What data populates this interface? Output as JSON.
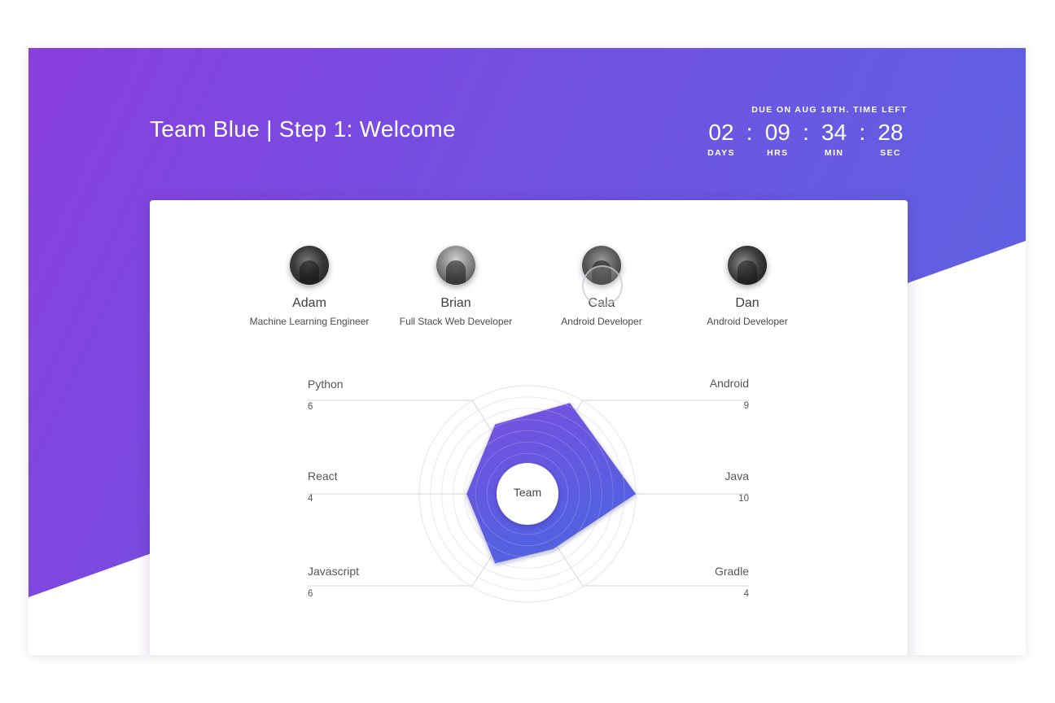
{
  "header": {
    "title": "Team Blue | Step 1: Welcome"
  },
  "countdown": {
    "caption": "DUE ON AUG 18TH. TIME LEFT",
    "days": "02",
    "hours": "09",
    "minutes": "34",
    "seconds": "28",
    "separator": ":",
    "days_label": "DAYS",
    "hours_label": "HRS",
    "minutes_label": "MIN",
    "seconds_label": "SEC"
  },
  "members": [
    {
      "name": "Adam",
      "role": "Machine Learning Engineer"
    },
    {
      "name": "Brian",
      "role": "Full Stack Web Developer"
    },
    {
      "name": "Cala",
      "role": "Android Developer"
    },
    {
      "name": "Dan",
      "role": "Android Developer"
    }
  ],
  "chart_data": {
    "type": "radar",
    "center_label": "Team",
    "axes": [
      "Python",
      "Android",
      "Java",
      "Gradle",
      "Javascript",
      "React"
    ],
    "values": [
      6,
      9,
      10,
      4,
      6,
      4
    ],
    "max": 10,
    "fill_color_top": "#7a4fe0",
    "fill_color_bottom": "#4f63e0"
  },
  "skills": {
    "python": {
      "name": "Python",
      "value": "6"
    },
    "react": {
      "name": "React",
      "value": "4"
    },
    "javascript": {
      "name": "Javascript",
      "value": "6"
    },
    "android": {
      "name": "Android",
      "value": "9"
    },
    "java": {
      "name": "Java",
      "value": "10"
    },
    "gradle": {
      "name": "Gradle",
      "value": "4"
    }
  }
}
